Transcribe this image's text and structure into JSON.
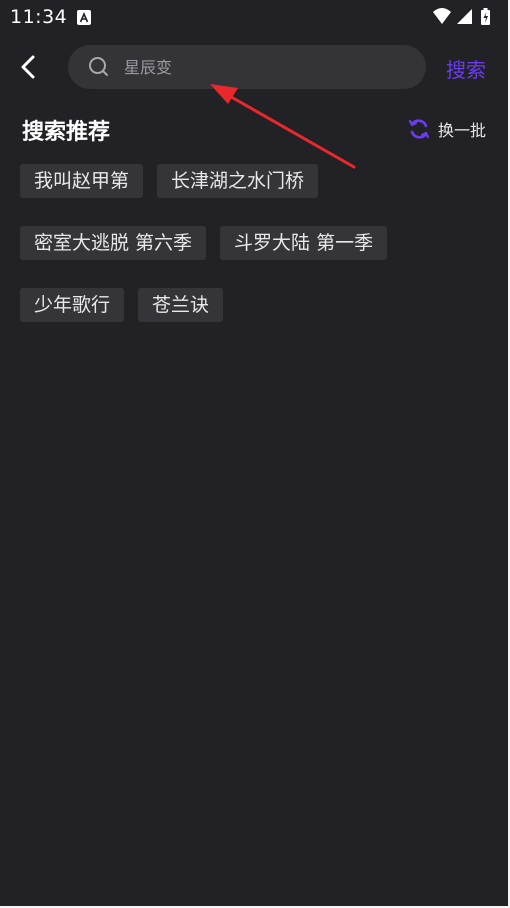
{
  "status_bar": {
    "time": "11:34",
    "icons": [
      "app-notification-icon",
      "wifi-icon",
      "signal-icon",
      "battery-icon"
    ]
  },
  "header": {
    "back_icon": "chevron-left-icon",
    "search_icon": "search-icon",
    "search_placeholder": "星辰变",
    "search_value": "",
    "search_button_label": "搜索"
  },
  "recommendations": {
    "title": "搜索推荐",
    "refresh_icon": "refresh-icon",
    "refresh_label": "换一批",
    "tags": [
      {
        "label": "我叫赵甲第"
      },
      {
        "label": "长津湖之水门桥"
      },
      {
        "label": "密室大逃脱 第六季"
      },
      {
        "label": "斗罗大陆 第一季"
      },
      {
        "label": "少年歌行"
      },
      {
        "label": "苍兰诀"
      }
    ]
  },
  "colors": {
    "background": "#222226",
    "accent": "#6b3cf0",
    "search_box": "#333338",
    "tag_background": "#353539",
    "annotation": "#e8282d"
  }
}
